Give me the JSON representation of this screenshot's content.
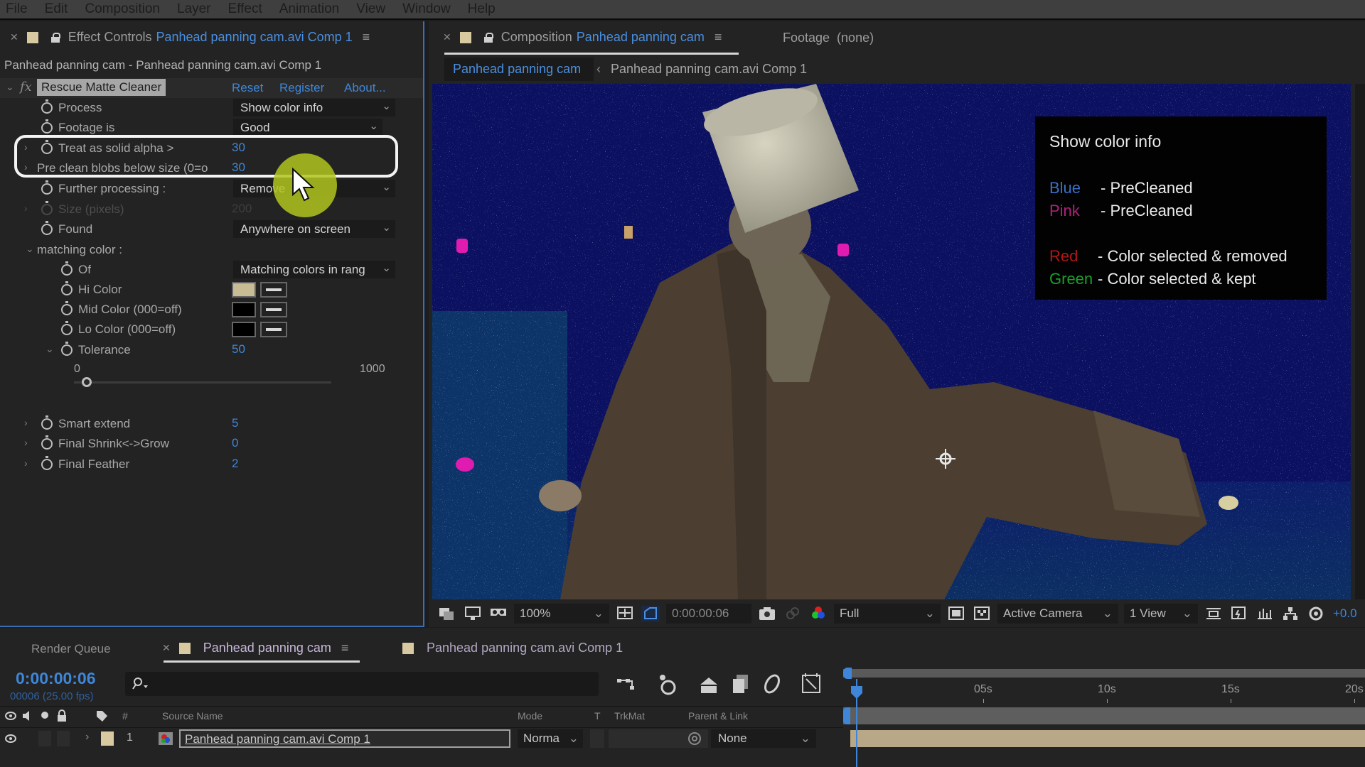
{
  "menubar": {
    "items": [
      "File",
      "Edit",
      "Composition",
      "Layer",
      "Effect",
      "Animation",
      "View",
      "Window",
      "Help"
    ]
  },
  "effect_controls": {
    "tab_label": "Effect Controls",
    "tab_target": "Panhead panning cam.avi Comp 1",
    "breadcrumb": "Panhead panning cam - Panhead panning cam.avi Comp 1",
    "effect_name": "Rescue Matte Cleaner",
    "links": {
      "reset": "Reset",
      "register": "Register",
      "about": "About..."
    },
    "properties": {
      "process": {
        "label": "Process",
        "value": "Show color info"
      },
      "footage_is": {
        "label": "Footage is",
        "value": "Good"
      },
      "treat_solid_alpha": {
        "label": "Treat as solid alpha >",
        "value": "30"
      },
      "pre_clean_blobs": {
        "label": "Pre clean blobs below size (0=o",
        "value": "30"
      },
      "further_processing": {
        "label": "Further processing :",
        "value": "Remove"
      },
      "size_pixels": {
        "label": "Size (pixels)",
        "value": "200"
      },
      "found": {
        "label": "Found",
        "value": "Anywhere on screen"
      },
      "matching_color": {
        "label": "matching color :"
      },
      "of": {
        "label": "Of",
        "value": "Matching colors in rang"
      },
      "hi_color": {
        "label": "Hi Color",
        "color": "#c8bc94"
      },
      "mid_color": {
        "label": "Mid Color (000=off)",
        "color": "#000000"
      },
      "lo_color": {
        "label": "Lo Color (000=off)",
        "color": "#000000"
      },
      "tolerance": {
        "label": "Tolerance",
        "value": "50",
        "slider_min": "0",
        "slider_max": "1000",
        "slider_fraction": 0.05
      },
      "smart_extend": {
        "label": "Smart extend",
        "value": "5"
      },
      "final_shrink_grow": {
        "label": "Final Shrink<->Grow",
        "value": "0"
      },
      "final_feather": {
        "label": "Final Feather",
        "value": "2"
      }
    }
  },
  "composition": {
    "tab_label": "Composition",
    "tab_target": "Panhead panning cam",
    "footage_tab": "Footage  (none)",
    "breadcrumb_active": "Panhead panning cam",
    "breadcrumb_next": "Panhead panning cam.avi Comp 1",
    "overlay": {
      "title": "Show color info",
      "legend": [
        {
          "color_name": "Blue",
          "color": "#3a6fc8",
          "desc": "- PreCleaned"
        },
        {
          "color_name": "Pink",
          "color": "#b0207a",
          "desc": "- PreCleaned"
        },
        {
          "color_name": "Red",
          "color": "#b01818",
          "desc": "- Color selected & removed"
        },
        {
          "color_name": "Green",
          "color": "#1aa02a",
          "desc": "- Color selected & kept"
        }
      ]
    },
    "toolbar": {
      "zoom": "100%",
      "timecode": "0:00:00:06",
      "resolution": "Full",
      "camera": "Active Camera",
      "views": "1 View",
      "exposure": "+0.0"
    }
  },
  "timeline": {
    "tabs": {
      "render_queue": "Render Queue",
      "active": "Panhead panning cam",
      "other": "Panhead panning cam.avi Comp 1"
    },
    "current_time": "0:00:00:06",
    "frame_info": "00006 (25.00 fps)",
    "search_placeholder": "",
    "ruler_ticks": [
      "05s",
      "10s",
      "15s",
      "20s"
    ],
    "columns": {
      "num": "#",
      "source_name": "Source Name",
      "mode": "Mode",
      "t": "T",
      "trkmat": "TrkMat",
      "parent": "Parent & Link"
    },
    "layers": [
      {
        "index": "1",
        "name": "Panhead panning cam.avi Comp 1",
        "mode": "Norma",
        "parent": "None",
        "label_color": "#d8c9a0"
      }
    ]
  },
  "colors": {
    "accent_blue": "#3f86d8",
    "cursor_highlight": "#b6c828",
    "layer_bar": "#b8a888"
  }
}
